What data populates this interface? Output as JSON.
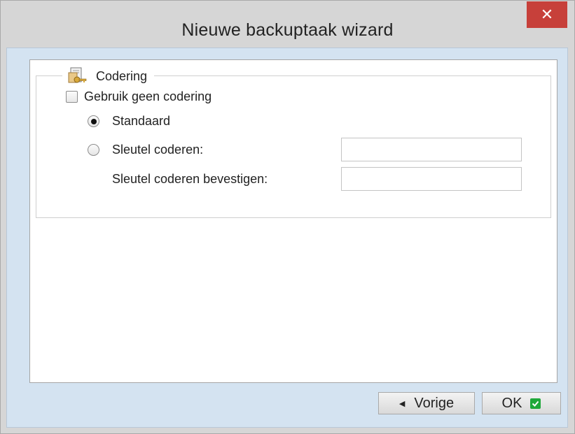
{
  "window": {
    "title": "Nieuwe backuptaak wizard"
  },
  "group": {
    "legend": "Codering",
    "legend_icon": "key-document-icon"
  },
  "options": {
    "no_encryption_label": "Gebruik geen codering",
    "no_encryption_checked": false,
    "standard_label": "Standaard",
    "standard_selected": true,
    "custom_key_label": "Sleutel coderen:",
    "custom_key_selected": false,
    "confirm_key_label": "Sleutel coderen bevestigen:",
    "custom_key_value": "",
    "confirm_key_value": ""
  },
  "footer": {
    "back_label": "Vorige",
    "ok_label": "OK"
  },
  "colors": {
    "close_button": "#c7403a",
    "client_background": "#d4e3f1",
    "ok_check": "#1fa83a"
  }
}
